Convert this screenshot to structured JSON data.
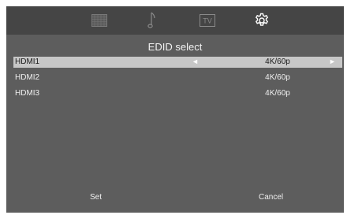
{
  "tabs": [
    {
      "icon": "picture-grid-icon",
      "active": false
    },
    {
      "icon": "music-note-icon",
      "active": false
    },
    {
      "icon": "tv-icon",
      "label": "TV",
      "active": false
    },
    {
      "icon": "gear-icon",
      "active": true
    }
  ],
  "title": "EDID select",
  "rows": [
    {
      "label": "HDMI1",
      "value": "4K/60p",
      "selected": true
    },
    {
      "label": "HDMI2",
      "value": "4K/60p",
      "selected": false
    },
    {
      "label": "HDMI3",
      "value": "4K/60p",
      "selected": false
    }
  ],
  "arrows": {
    "left": "◄",
    "right": "►"
  },
  "buttons": {
    "set": "Set",
    "cancel": "Cancel"
  },
  "colors": {
    "panel": "#5d5d5d",
    "topbar": "#454545",
    "highlight": "#c7c7c7"
  }
}
